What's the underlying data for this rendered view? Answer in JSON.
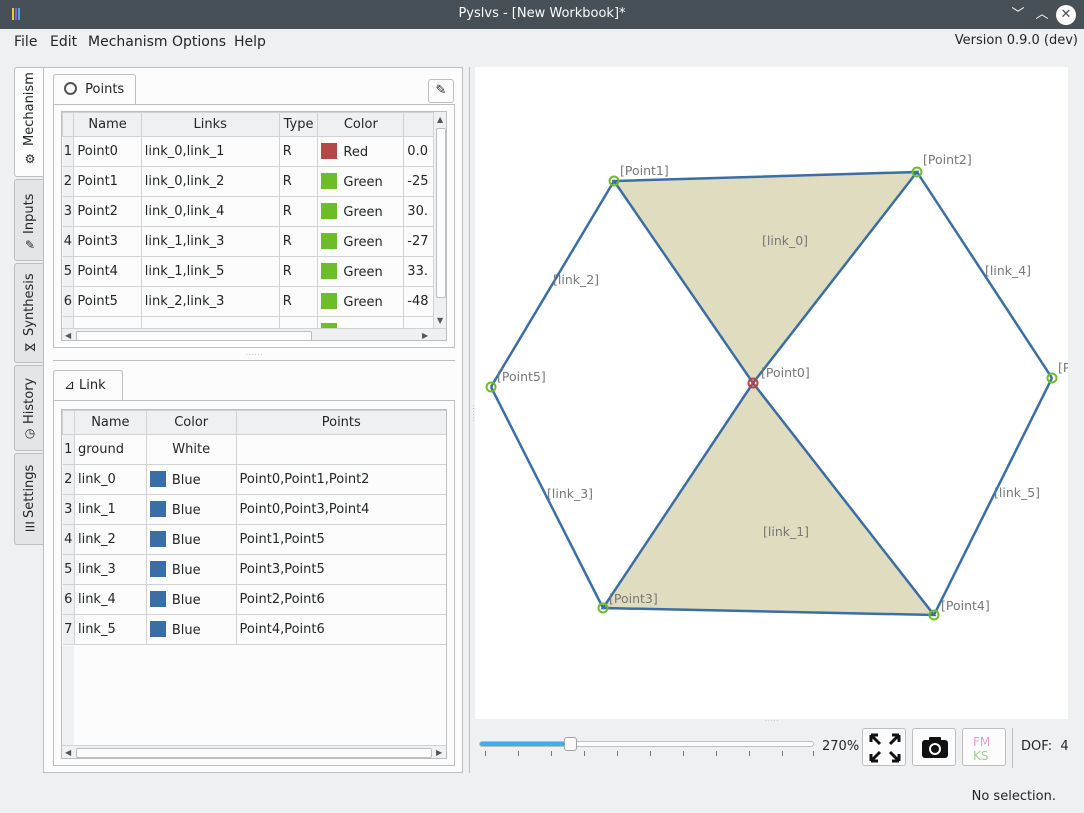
{
  "window": {
    "title": "Pyslvs - [New Workbook]*"
  },
  "menubar": {
    "items": [
      {
        "label": "File"
      },
      {
        "label": "Edit"
      },
      {
        "label": "Mechanism"
      },
      {
        "label": "Options"
      },
      {
        "label": "Help"
      }
    ],
    "version": "Version 0.9.0 (dev)"
  },
  "side_tabs": [
    {
      "label": "Mechanism",
      "icon": "gear-icon"
    },
    {
      "label": "Inputs",
      "icon": "input-icon"
    },
    {
      "label": "Synthesis",
      "icon": "synthesis-icon"
    },
    {
      "label": "History",
      "icon": "history-icon"
    },
    {
      "label": "Settings",
      "icon": "settings-icon"
    }
  ],
  "points_panel": {
    "tab_label": "Points",
    "columns": [
      "Name",
      "Links",
      "Type",
      "Color",
      ""
    ],
    "rows": [
      {
        "n": "1",
        "name": "Point0",
        "links": "link_0,link_1",
        "type": "R",
        "color": "Red",
        "swatch": "#b54747",
        "x": "0.0"
      },
      {
        "n": "2",
        "name": "Point1",
        "links": "link_0,link_2",
        "type": "R",
        "color": "Green",
        "swatch": "#6dbd2a",
        "x": "-25"
      },
      {
        "n": "3",
        "name": "Point2",
        "links": "link_0,link_4",
        "type": "R",
        "color": "Green",
        "swatch": "#6dbd2a",
        "x": "30."
      },
      {
        "n": "4",
        "name": "Point3",
        "links": "link_1,link_3",
        "type": "R",
        "color": "Green",
        "swatch": "#6dbd2a",
        "x": "-27"
      },
      {
        "n": "5",
        "name": "Point4",
        "links": "link_1,link_5",
        "type": "R",
        "color": "Green",
        "swatch": "#6dbd2a",
        "x": "33."
      },
      {
        "n": "6",
        "name": "Point5",
        "links": "link_2,link_3",
        "type": "R",
        "color": "Green",
        "swatch": "#6dbd2a",
        "x": "-48"
      }
    ]
  },
  "links_panel": {
    "tab_label": "Link",
    "columns": [
      "Name",
      "Color",
      "Points"
    ],
    "rows": [
      {
        "n": "1",
        "name": "ground",
        "color": "White",
        "swatch": "",
        "points": ""
      },
      {
        "n": "2",
        "name": "link_0",
        "color": "Blue",
        "swatch": "#3a6ea5",
        "points": "Point0,Point1,Point2"
      },
      {
        "n": "3",
        "name": "link_1",
        "color": "Blue",
        "swatch": "#3a6ea5",
        "points": "Point0,Point3,Point4"
      },
      {
        "n": "4",
        "name": "link_2",
        "color": "Blue",
        "swatch": "#3a6ea5",
        "points": "Point1,Point5"
      },
      {
        "n": "5",
        "name": "link_3",
        "color": "Blue",
        "swatch": "#3a6ea5",
        "points": "Point3,Point5"
      },
      {
        "n": "6",
        "name": "link_4",
        "color": "Blue",
        "swatch": "#3a6ea5",
        "points": "Point2,Point6"
      },
      {
        "n": "7",
        "name": "link_5",
        "color": "Blue",
        "swatch": "#3a6ea5",
        "points": "Point4,Point6"
      }
    ]
  },
  "canvas": {
    "point_labels": [
      "[Point0]",
      "[Point1]",
      "[Point2]",
      "[Point3]",
      "[Point4]",
      "[Point5]",
      "[P"
    ],
    "link_labels": [
      "[link_0]",
      "[link_1]",
      "[link_2]",
      "[link_3]",
      "[link_4]",
      "[link_5]"
    ],
    "colors": {
      "link": "#3a6ea5",
      "fill": "#e0dcc0",
      "point": "#6dbd2a",
      "origin": "#b54747"
    }
  },
  "zoom": {
    "label": "270%",
    "value": 270
  },
  "toolbar": {
    "fit_icon": "fit-view-icon",
    "camera_icon": "camera-icon",
    "fmks_icon": "fmks-logo-icon"
  },
  "dof": {
    "label": "DOF:",
    "value": "4"
  },
  "status": "No selection."
}
